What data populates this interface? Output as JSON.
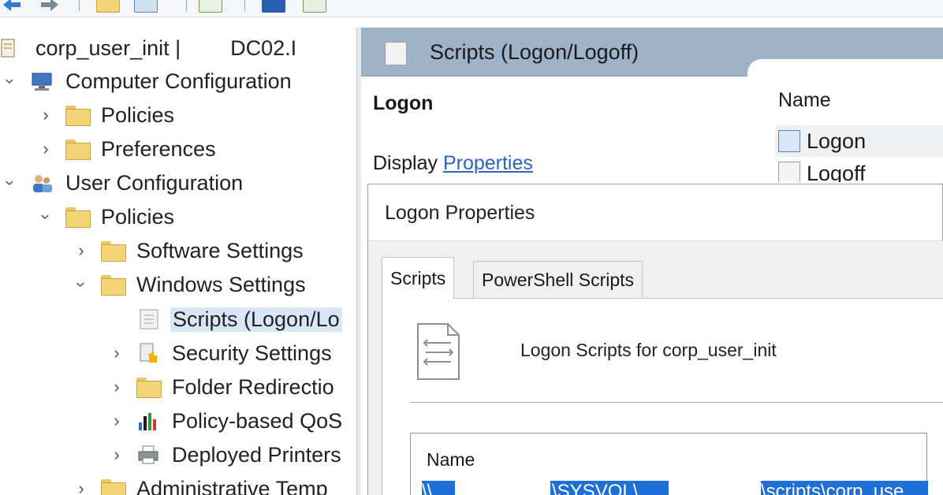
{
  "toolbar": {
    "buttons": [
      "back-arrow-icon",
      "forward-arrow-icon",
      "up-folder-icon",
      "show-hide-tree-icon",
      "export-list-icon",
      "help-icon",
      "properties-icon"
    ]
  },
  "tree": {
    "root": {
      "label": "corp_user_init |",
      "dc": "DC02.I"
    },
    "items": [
      {
        "label": "Computer Configuration"
      },
      {
        "label": "Policies"
      },
      {
        "label": "Preferences"
      },
      {
        "label": "User Configuration"
      },
      {
        "label": "Policies"
      },
      {
        "label": "Software Settings"
      },
      {
        "label": "Windows Settings"
      },
      {
        "label": "Scripts (Logon/Lo"
      },
      {
        "label": "Security Settings"
      },
      {
        "label": "Folder Redirectio"
      },
      {
        "label": "Policy-based QoS"
      },
      {
        "label": "Deployed Printers"
      },
      {
        "label": "Administrative Temp"
      }
    ]
  },
  "pane": {
    "header_title": "Scripts (Logon/Logoff)",
    "section": "Logon",
    "display_prefix": "Display",
    "properties_link": "Properties",
    "column_name": "Name",
    "rows": [
      "Logon",
      "Logoff"
    ]
  },
  "dialog": {
    "title": "Logon Properties",
    "tabs": [
      "Scripts",
      "PowerShell Scripts"
    ],
    "heading": "Logon Scripts for corp_user_init",
    "list_header": "Name",
    "selected_row_parts": [
      "\\\\",
      "\\SYSVOL\\",
      "\\scripts\\corp_use"
    ]
  },
  "colors": {
    "selection": "#1e6fd6",
    "link": "#2a65c6",
    "header": "#9fb3c8"
  }
}
